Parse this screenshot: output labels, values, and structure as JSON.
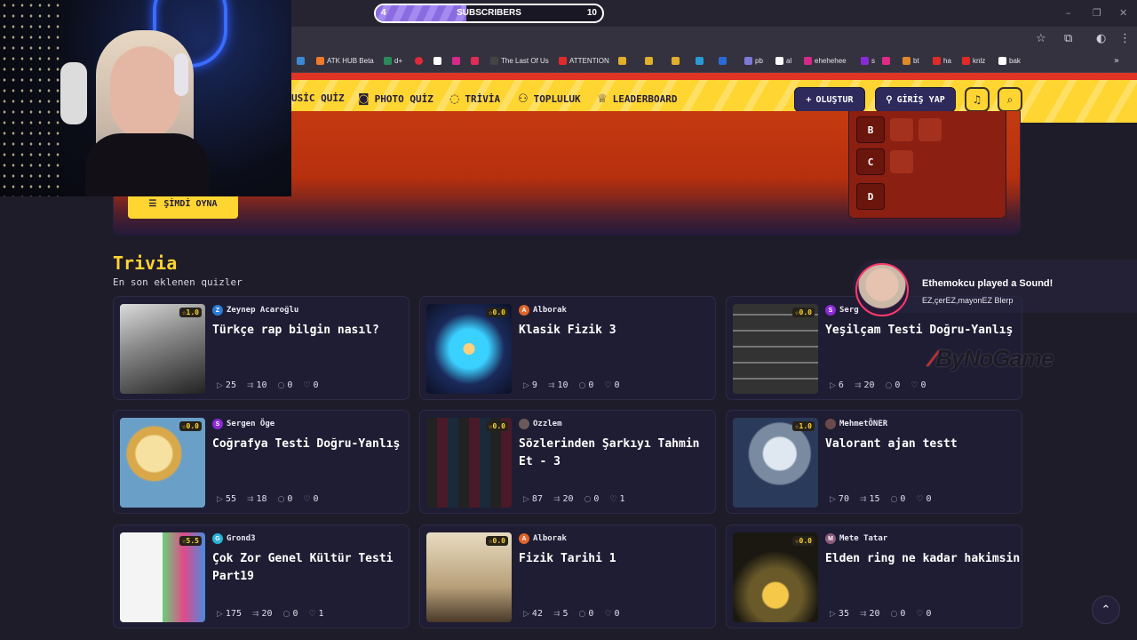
{
  "subscribers": {
    "label": "SUBSCRIBERS",
    "current": "4",
    "goal": "10",
    "progress": 0.4
  },
  "bookmarks": [
    "ATK HUB Beta",
    "d+",
    "The Last Of Us",
    "ATTENTION",
    "pb",
    "al",
    "ehehehee",
    "s",
    "bt",
    "ha",
    "knlz",
    "bak"
  ],
  "nav": {
    "music_quiz": "USİC QUİZ",
    "photo_quiz": "PHOTO QUİZ",
    "trivia": "TRİVİA",
    "community": "TOPLULUK",
    "leaderboard": "LEADERBOARD",
    "create": "OLUŞTUR",
    "login": "GİRİŞ YAP"
  },
  "hero": {
    "play_label": "ŞİMDİ OYNA",
    "answers": [
      "B",
      "C",
      "D"
    ]
  },
  "section": {
    "title": "Trivia",
    "subtitle": "En son eklenen quizler"
  },
  "cards": [
    {
      "author": "Zeynep Acaroğlu",
      "initial": "Z",
      "avatar_color": "#2a7bd6",
      "title": "Türkçe rap bilgin nasıl?",
      "rating": "1.0",
      "plays": "25",
      "questions": "10",
      "comments": "0",
      "likes": "0"
    },
    {
      "author": "Alborak",
      "initial": "A",
      "avatar_color": "#e0642a",
      "title": "Klasik Fizik 3",
      "rating": "0.0",
      "plays": "9",
      "questions": "10",
      "comments": "0",
      "likes": "0"
    },
    {
      "author": "Serg",
      "initial": "S",
      "avatar_color": "#8a2ad6",
      "title": "Yeşilçam Testi Doğru-Yanlış",
      "rating": "0.0",
      "plays": "6",
      "questions": "20",
      "comments": "0",
      "likes": "0"
    },
    {
      "author": "Sergen Öge",
      "initial": "S",
      "avatar_color": "#8a2ad6",
      "title": "Coğrafya Testi Doğru-Yanlış",
      "rating": "0.0",
      "plays": "55",
      "questions": "18",
      "comments": "0",
      "likes": "0"
    },
    {
      "author": "Ozzlem",
      "initial": "",
      "avatar_color": "#6a5a5a",
      "title": "Sözlerinden Şarkıyı Tahmin Et - 3",
      "rating": "0.0",
      "plays": "87",
      "questions": "20",
      "comments": "0",
      "likes": "1"
    },
    {
      "author": "MehmetÖNER",
      "initial": "",
      "avatar_color": "#6a4a4a",
      "title": "Valorant ajan testt",
      "rating": "1.0",
      "plays": "70",
      "questions": "15",
      "comments": "0",
      "likes": "0"
    },
    {
      "author": "Grond3",
      "initial": "G",
      "avatar_color": "#2ab2d6",
      "title": "Çok Zor Genel Kültür Testi Part19",
      "rating": "5.5",
      "plays": "175",
      "questions": "20",
      "comments": "0",
      "likes": "1"
    },
    {
      "author": "Alborak",
      "initial": "A",
      "avatar_color": "#e0642a",
      "title": "Fizik Tarihi 1",
      "rating": "0.0",
      "plays": "42",
      "questions": "5",
      "comments": "0",
      "likes": "0"
    },
    {
      "author": "Mete Tatar",
      "initial": "M",
      "avatar_color": "#8a5a7a",
      "title": "Elden ring ne kadar hakimsin",
      "rating": "0.0",
      "plays": "35",
      "questions": "20",
      "comments": "0",
      "likes": "0"
    }
  ],
  "overlay": {
    "title": "Ethemokcu played a Sound!",
    "subtitle": "EZ,çerEZ,mayonEZ Blerp",
    "brand": "ByNoGame"
  },
  "colors": {
    "accent": "#ffd531",
    "header_red": "#e03524",
    "card_bg": "#1f1d33",
    "page_bg": "#1f1c2a"
  }
}
